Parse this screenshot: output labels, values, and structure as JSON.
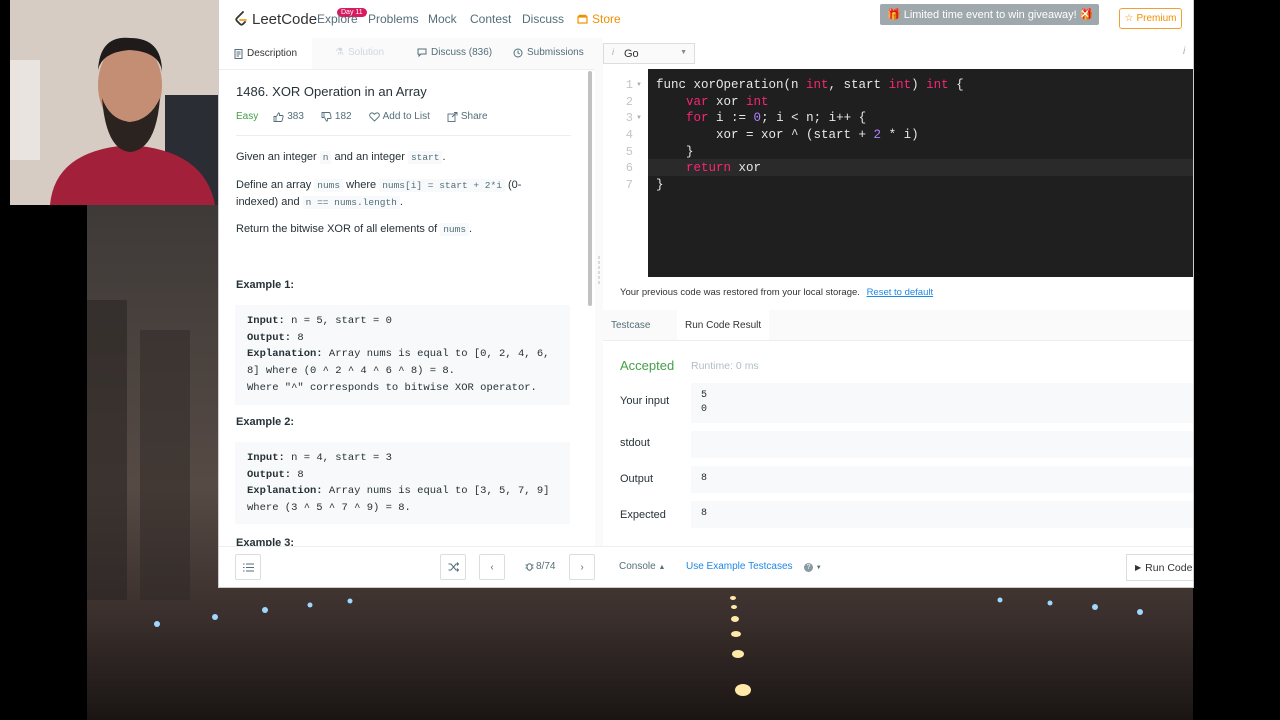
{
  "nav": {
    "logo": "LeetCode",
    "items": [
      "Explore",
      "Problems",
      "Mock",
      "Contest",
      "Discuss",
      "Store"
    ],
    "badge": "Day 11",
    "promo": "Limited time event to win giveaway!",
    "premium": "Premium"
  },
  "left_tabs": {
    "description": "Description",
    "solution": "Solution",
    "discuss": "Discuss (836)",
    "submissions": "Submissions"
  },
  "problem": {
    "title": "1486. XOR Operation in an Array",
    "difficulty": "Easy",
    "likes": "383",
    "dislikes": "182",
    "add_to_list": "Add to List",
    "share": "Share",
    "p1_a": "Given an integer",
    "p1_code1": "n",
    "p1_b": "and an integer",
    "p1_code2": "start",
    "p1_c": ".",
    "p2_a": "Define an array",
    "p2_code1": "nums",
    "p2_b": "where",
    "p2_code2": "nums[i] = start + 2*i",
    "p2_c": "(0-indexed) and",
    "p2_code3": "n == nums.length",
    "p2_d": ".",
    "p3_a": "Return the bitwise XOR of all elements of",
    "p3_code": "nums",
    "p3_b": ".",
    "example1_title": "Example 1:",
    "example1": {
      "input_label": "Input:",
      "input": " n = 5, start = 0",
      "output_label": "Output:",
      "output": " 8",
      "expl_label": "Explanation:",
      "expl1": " Array nums is equal to [0, 2, 4, 6,",
      "expl2": "8] where (0 ^ 2 ^ 4 ^ 6 ^ 8) = 8.",
      "expl3": "Where \"^\" corresponds to bitwise XOR operator."
    },
    "example2_title": "Example 2:",
    "example2": {
      "input_label": "Input:",
      "input": " n = 4, start = 3",
      "output_label": "Output:",
      "output": " 8",
      "expl_label": "Explanation:",
      "expl1": " Array nums is equal to [3, 5, 7, 9]",
      "expl2": "where (3 ^ 5 ^ 7 ^ 9) = 8."
    },
    "example3_title": "Example 3:"
  },
  "editor": {
    "language": "Go",
    "line_numbers": [
      "1",
      "2",
      "3",
      "4",
      "5",
      "6",
      "7"
    ],
    "l1_a": "func xorOperation(n ",
    "l1_b": "int",
    "l1_c": ", start ",
    "l1_d": "int",
    "l1_e": ") ",
    "l1_f": "int",
    "l1_g": " {",
    "l2_a": "    ",
    "l2_b": "var",
    "l2_c": " xor ",
    "l2_d": "int",
    "l3_a": "    ",
    "l3_b": "for",
    "l3_c": " i := ",
    "l3_d": "0",
    "l3_e": "; i < n; i++ {",
    "l4_a": "        xor = xor ^ (start + ",
    "l4_b": "2",
    "l4_c": " * i)",
    "l5": "    }",
    "l6_a": "    ",
    "l6_b": "return",
    "l6_c": " xor",
    "l7": "}"
  },
  "console": {
    "restored": "Your previous code was restored from your local storage.",
    "reset": "Reset to default",
    "tab_testcase": "Testcase",
    "tab_result": "Run Code Result",
    "status": "Accepted",
    "runtime": "Runtime: 0 ms",
    "your_input_label": "Your input",
    "your_input": "5\n0",
    "stdout_label": "stdout",
    "stdout": "",
    "output_label": "Output",
    "output": "8",
    "expected_label": "Expected",
    "expected": "8"
  },
  "bottom": {
    "pager": "8/74",
    "console": "Console",
    "use_example": "Use Example Testcases",
    "run_code": "Run Code"
  },
  "colors": {
    "accepted": "#43a047",
    "link": "#1e88e5",
    "keyword": "#f92672",
    "number": "#ae81ff",
    "store": "#f09000"
  }
}
